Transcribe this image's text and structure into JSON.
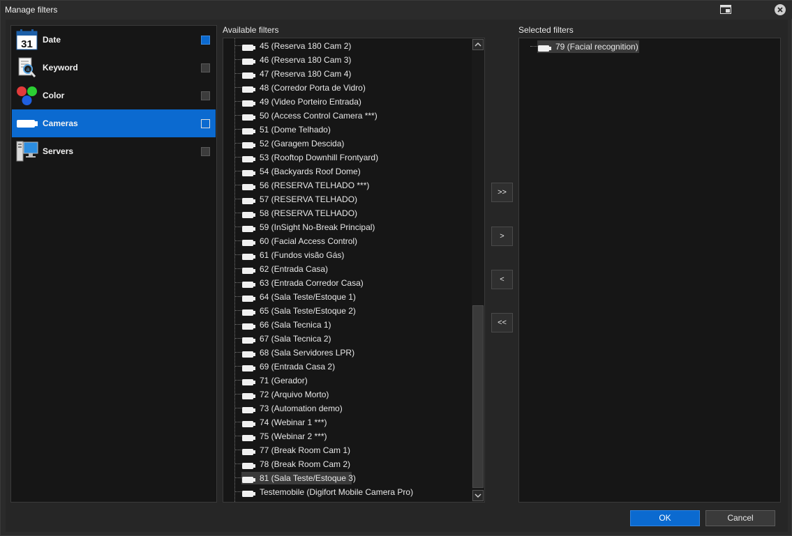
{
  "window": {
    "title": "Manage filters"
  },
  "categories": [
    {
      "label": "Date",
      "icon": "calendar-icon",
      "icon_text": "31",
      "selected": false,
      "check": "filled"
    },
    {
      "label": "Keyword",
      "icon": "keyword-icon",
      "selected": false,
      "check": "empty"
    },
    {
      "label": "Color",
      "icon": "color-icon",
      "selected": false,
      "check": "empty"
    },
    {
      "label": "Cameras",
      "icon": "camera-icon",
      "selected": true,
      "check": "outline"
    },
    {
      "label": "Servers",
      "icon": "server-icon",
      "selected": false,
      "check": "empty"
    }
  ],
  "available": {
    "header": "Available filters",
    "items": [
      "45 (Reserva 180 Cam 2)",
      "46 (Reserva 180 Cam 3)",
      "47 (Reserva 180 Cam 4)",
      "48 (Corredor Porta de Vidro)",
      "49 (Video Porteiro Entrada)",
      "50 (Access Control Camera ***)",
      "51 (Dome Telhado)",
      "52 (Garagem Descida)",
      "53 (Rooftop Downhill Frontyard)",
      "54 (Backyards Roof Dome)",
      "56 (RESERVA TELHADO ***)",
      "57 (RESERVA TELHADO)",
      "58 (RESERVA TELHADO)",
      "59 (InSight No-Break Principal)",
      "60 (Facial Access Control)",
      "61 (Fundos visão Gás)",
      "62 (Entrada Casa)",
      "63 (Entrada Corredor Casa)",
      "64 (Sala Teste/Estoque 1)",
      "65 (Sala Teste/Estoque 2)",
      "66 (Sala Tecnica 1)",
      "67 (Sala Tecnica 2)",
      "68 (Sala Servidores LPR)",
      "69 (Entrada Casa 2)",
      "71 (Gerador)",
      "72 (Arquivo Morto)",
      "73 (Automation demo)",
      "74 (Webinar 1 ***)",
      "75 (Webinar 2 ***)",
      "77 (Break Room Cam 1)",
      "78 (Break Room Cam 2)",
      "81 (Sala Teste/Estoque 3)",
      "Testemobile (Digifort Mobile Camera Pro)"
    ],
    "highlighted_index": 31
  },
  "transfer": {
    "add_all": ">>",
    "add": ">",
    "remove": "<",
    "remove_all": "<<"
  },
  "selected": {
    "header": "Selected filters",
    "items": [
      "79 (Facial recognition)"
    ]
  },
  "footer": {
    "ok": "OK",
    "cancel": "Cancel"
  },
  "colors": {
    "accent": "#0b6ad0",
    "panel_bg": "#161616",
    "window_bg": "#2b2b2b"
  }
}
